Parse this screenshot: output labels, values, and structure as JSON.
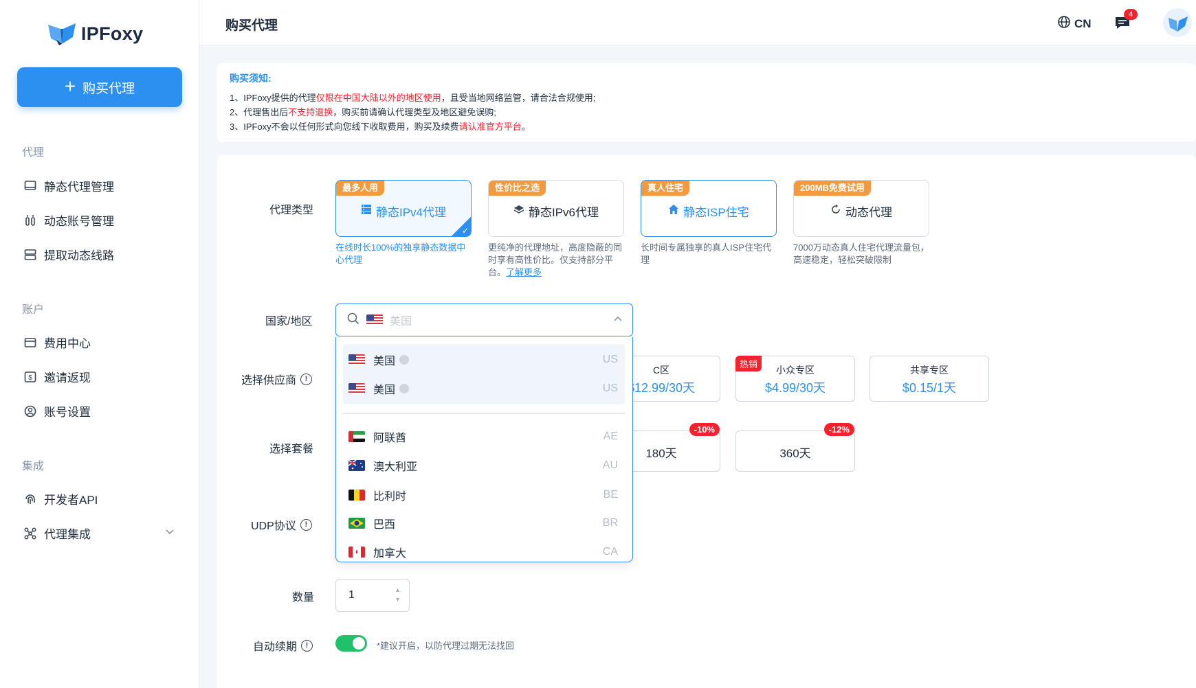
{
  "brand": {
    "name": "IPFoxy"
  },
  "sidebar": {
    "buy_button": "购买代理",
    "sections": [
      {
        "title": "代理",
        "items": [
          "静态代理管理",
          "动态账号管理",
          "提取动态线路"
        ]
      },
      {
        "title": "账户",
        "items": [
          "费用中心",
          "邀请返现",
          "账号设置"
        ]
      },
      {
        "title": "集成",
        "items": [
          "开发者API",
          "代理集成"
        ]
      }
    ]
  },
  "header": {
    "title": "购买代理",
    "lang": "CN",
    "msg_count": "4"
  },
  "notice": {
    "title": "购买须知:",
    "line1_a": "1、IPFoxy提供的代理",
    "line1_red": "仅限在中国大陆以外的地区使用",
    "line1_b": "，且受当地网络监管，请合法合规使用;",
    "line2_a": "2、代理售出后",
    "line2_red": "不支持退换",
    "line2_b": "，购买前请确认代理类型及地区避免误购;",
    "line3_a": "3、IPFoxy不会以任何形式向您线下收取费用，购买及续费",
    "line3_red": "请认准官方平台",
    "line3_b": "。"
  },
  "form": {
    "proxy_type_label": "代理类型",
    "country_label": "国家/地区",
    "supplier_label": "选择供应商",
    "package_label": "选择套餐",
    "udp_label": "UDP协议",
    "qty_label": "数量",
    "renew_label": "自动续期",
    "qty_value": "1",
    "renew_note": "*建议开启，以防代理过期无法找回",
    "country_placeholder": "美国"
  },
  "proxy_types": [
    {
      "tag": "最多人用",
      "label": "静态IPv4代理",
      "desc": "在线时长100%的独享静态数据中心代理",
      "selected": true
    },
    {
      "tag": "性价比之选",
      "label": "静态IPv6代理",
      "desc": "更纯净的代理地址，高度隐蔽的同时享有高性价比。仅支持部分平台。",
      "link": "了解更多"
    },
    {
      "tag": "真人住宅",
      "label": "静态ISP住宅",
      "desc": "长时间专属独享的真人ISP住宅代理"
    },
    {
      "tag": "200MB免费试用",
      "label": "动态代理",
      "desc": "7000万动态真人住宅代理流量包，高速稳定，轻松突破限制"
    }
  ],
  "suppliers": [
    {
      "name": "C区",
      "price": "$12.99/30天"
    },
    {
      "name": "小众专区",
      "price": "$4.99/30天",
      "tag": "热销"
    },
    {
      "name": "共享专区",
      "price": "$0.15/1天"
    }
  ],
  "packages": [
    {
      "label": "180天",
      "discount": "-10%"
    },
    {
      "label": "360天",
      "discount": "-12%"
    }
  ],
  "countries": [
    {
      "name": "美国",
      "code": "US",
      "pinned": true
    },
    {
      "name": "美国",
      "code": "US",
      "pinned": true
    },
    {
      "name": "阿联酋",
      "code": "AE"
    },
    {
      "name": "澳大利亚",
      "code": "AU"
    },
    {
      "name": "比利时",
      "code": "BE"
    },
    {
      "name": "巴西",
      "code": "BR"
    },
    {
      "name": "加拿大",
      "code": "CA"
    }
  ],
  "colors": {
    "primary": "#2b90f0",
    "tag": "#f59a3c",
    "danger": "#f5222d",
    "toggle": "#21c16b"
  }
}
